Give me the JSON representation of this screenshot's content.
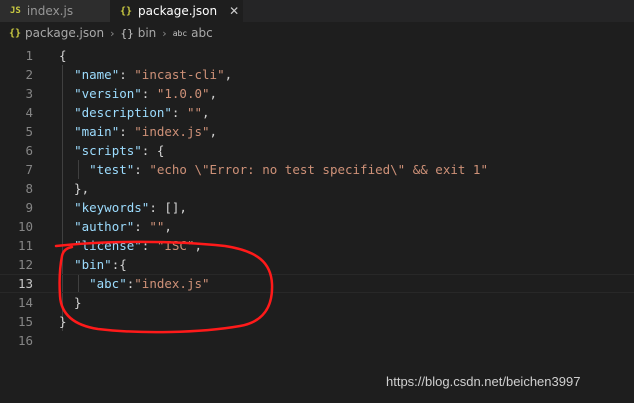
{
  "tabs": [
    {
      "icon": "JS",
      "label": "index.js"
    },
    {
      "icon": "{}",
      "label": "package.json",
      "close": "✕"
    }
  ],
  "breadcrumb": {
    "file_icon": "{}",
    "file": "package.json",
    "sep": "›",
    "obj_icon": "{}",
    "obj": "bin",
    "str_icon": "abc",
    "str": "abc"
  },
  "code_lines": [
    {
      "n": "1",
      "parts": [
        {
          "t": "p",
          "v": "{"
        }
      ]
    },
    {
      "n": "2",
      "parts": [
        {
          "t": "p",
          "v": "  "
        },
        {
          "t": "k",
          "v": "\"name\""
        },
        {
          "t": "p",
          "v": ": "
        },
        {
          "t": "s",
          "v": "\"incast-cli\""
        },
        {
          "t": "p",
          "v": ","
        }
      ]
    },
    {
      "n": "3",
      "parts": [
        {
          "t": "p",
          "v": "  "
        },
        {
          "t": "k",
          "v": "\"version\""
        },
        {
          "t": "p",
          "v": ": "
        },
        {
          "t": "s",
          "v": "\"1.0.0\""
        },
        {
          "t": "p",
          "v": ","
        }
      ]
    },
    {
      "n": "4",
      "parts": [
        {
          "t": "p",
          "v": "  "
        },
        {
          "t": "k",
          "v": "\"description\""
        },
        {
          "t": "p",
          "v": ": "
        },
        {
          "t": "s",
          "v": "\"\""
        },
        {
          "t": "p",
          "v": ","
        }
      ]
    },
    {
      "n": "5",
      "parts": [
        {
          "t": "p",
          "v": "  "
        },
        {
          "t": "k",
          "v": "\"main\""
        },
        {
          "t": "p",
          "v": ": "
        },
        {
          "t": "s",
          "v": "\"index.js\""
        },
        {
          "t": "p",
          "v": ","
        }
      ]
    },
    {
      "n": "6",
      "parts": [
        {
          "t": "p",
          "v": "  "
        },
        {
          "t": "k",
          "v": "\"scripts\""
        },
        {
          "t": "p",
          "v": ": {"
        }
      ]
    },
    {
      "n": "7",
      "parts": [
        {
          "t": "p",
          "v": "    "
        },
        {
          "t": "k",
          "v": "\"test\""
        },
        {
          "t": "p",
          "v": ": "
        },
        {
          "t": "s",
          "v": "\"echo \\\"Error: no test specified\\\" && exit 1\""
        }
      ]
    },
    {
      "n": "8",
      "parts": [
        {
          "t": "p",
          "v": "  },"
        }
      ]
    },
    {
      "n": "9",
      "parts": [
        {
          "t": "p",
          "v": "  "
        },
        {
          "t": "k",
          "v": "\"keywords\""
        },
        {
          "t": "p",
          "v": ": [],"
        }
      ]
    },
    {
      "n": "10",
      "parts": [
        {
          "t": "p",
          "v": "  "
        },
        {
          "t": "k",
          "v": "\"author\""
        },
        {
          "t": "p",
          "v": ": "
        },
        {
          "t": "s",
          "v": "\"\""
        },
        {
          "t": "p",
          "v": ","
        }
      ]
    },
    {
      "n": "11",
      "parts": [
        {
          "t": "p",
          "v": "  "
        },
        {
          "t": "k",
          "v": "\"license\""
        },
        {
          "t": "p",
          "v": ": "
        },
        {
          "t": "s",
          "v": "\"ISC\""
        },
        {
          "t": "p",
          "v": ","
        }
      ]
    },
    {
      "n": "12",
      "parts": [
        {
          "t": "p",
          "v": "  "
        },
        {
          "t": "k",
          "v": "\"bin\""
        },
        {
          "t": "p",
          "v": ":{"
        }
      ]
    },
    {
      "n": "13",
      "current": true,
      "parts": [
        {
          "t": "p",
          "v": "    "
        },
        {
          "t": "k",
          "v": "\"abc\""
        },
        {
          "t": "p",
          "v": ":"
        },
        {
          "t": "s",
          "v": "\"index.js\""
        }
      ]
    },
    {
      "n": "14",
      "parts": [
        {
          "t": "p",
          "v": "  }"
        }
      ]
    },
    {
      "n": "15",
      "parts": [
        {
          "t": "p",
          "v": "}"
        }
      ]
    },
    {
      "n": "16",
      "parts": []
    }
  ],
  "watermark": "https://blog.csdn.net/beichen3997",
  "colors": {
    "key": "#9cdcfe",
    "string": "#ce9178",
    "punctuation": "#d4d4d4",
    "annotation": "#ff1a1a"
  }
}
